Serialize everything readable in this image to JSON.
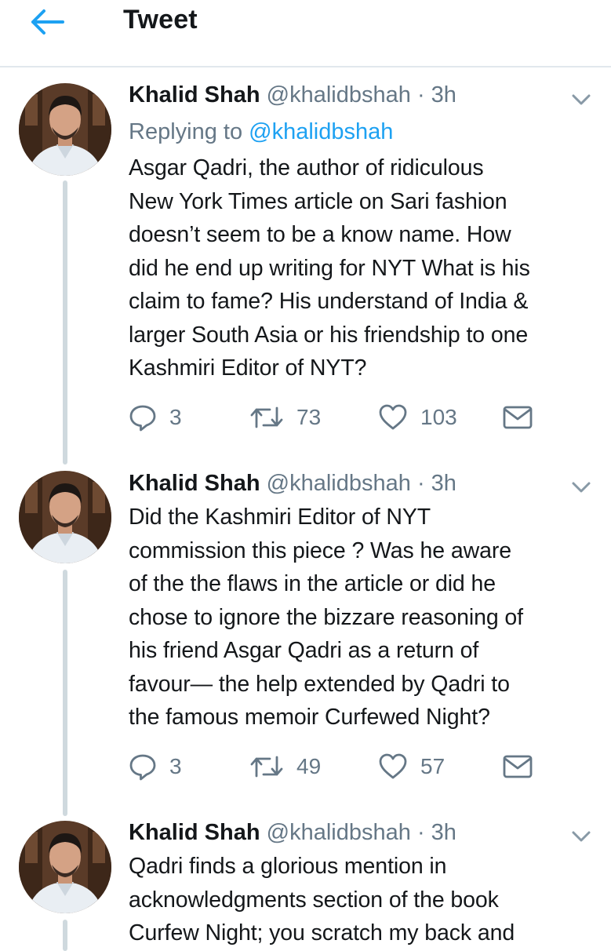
{
  "header": {
    "title": "Tweet",
    "back_icon": "arrow-left-icon",
    "accent": "#1da1f2"
  },
  "tweets": [
    {
      "name": "Khalid Shah",
      "handle": "@khalidbshah",
      "dot": "·",
      "time": "3h",
      "replying_prefix": "Replying to",
      "replying_to": "@khalidbshah",
      "lines": [
        "Asgar Qadri, the author of ridiculous",
        "New York Times article on Sari fashion",
        "doesn’t seem to be a know name. How",
        "did he end up writing for NYT What is his",
        "claim to fame? His understand of India &",
        "larger South Asia or his friendship to one",
        "Kashmiri Editor of NYT?"
      ],
      "replies": "3",
      "retweets": "73",
      "likes": "103"
    },
    {
      "name": "Khalid Shah",
      "handle": "@khalidbshah",
      "dot": "·",
      "time": "3h",
      "lines": [
        "Did the Kashmiri Editor of NYT",
        "commission this piece ? Was he aware",
        "of the the flaws in the article or did he",
        "chose to ignore the bizzare reasoning of",
        "his friend Asgar Qadri as a return of",
        "favour— the help extended by Qadri to",
        "the famous memoir Curfewed Night?"
      ],
      "replies": "3",
      "retweets": "49",
      "likes": "57"
    },
    {
      "name": "Khalid Shah",
      "handle": "@khalidbshah",
      "dot": "·",
      "time": "3h",
      "lines": [
        "Qadri finds a glorious mention in",
        "acknowledgments section of the book",
        "Curfew Night; you scratch my back and"
      ]
    }
  ],
  "icons": [
    "arrow-left-icon",
    "chevron-down-icon",
    "reply-icon",
    "retweet-icon",
    "like-icon",
    "dm-icon"
  ]
}
